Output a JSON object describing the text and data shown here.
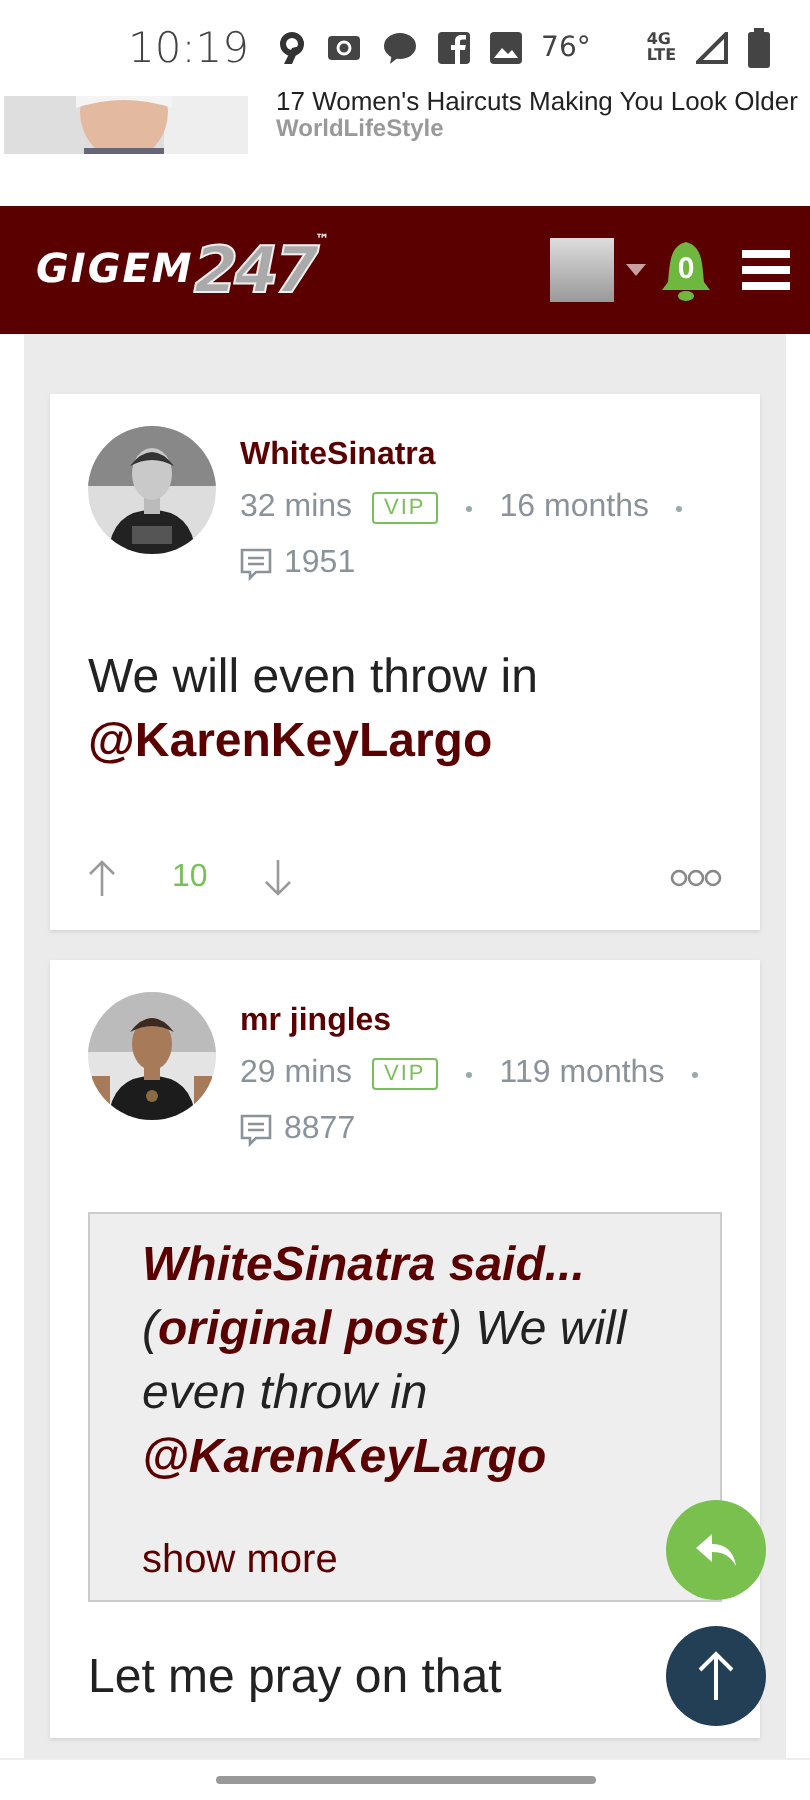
{
  "status_bar": {
    "time": "10:19",
    "temperature": "76°",
    "network_top": "4G",
    "network_bottom": "LTE"
  },
  "ad": {
    "headline": "17 Women's Haircuts Making You Look Older",
    "source": "WorldLifeStyle"
  },
  "header": {
    "logo_main": "GIGEM",
    "logo_accent": "247",
    "logo_mark": "™",
    "notifications": "0"
  },
  "posts": [
    {
      "author": "WhiteSinatra",
      "time": "32 mins",
      "badge": "VIP",
      "tenure": "16 months",
      "comments": "1951",
      "body": "We will even throw in **@KarenKeyLargo**",
      "votes": {
        "score": "10"
      }
    },
    {
      "author": "mr jingles",
      "time": "29 mins",
      "badge": "VIP",
      "tenure": "119 months",
      "comments": "8877",
      "quote": {
        "text": "**WhiteSinatra said...** (**original post**) We will even throw in **@KarenKeyLargo**",
        "show_more": "show more"
      },
      "body": "Let me pray on that"
    }
  ]
}
